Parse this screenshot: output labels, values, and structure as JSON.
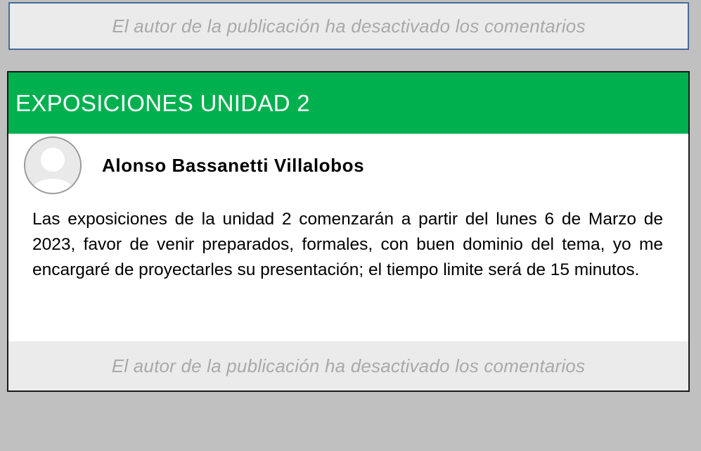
{
  "top_banner": {
    "comments_disabled_text": "El autor de la publicación ha desactivado los comentarios"
  },
  "post": {
    "title": "EXPOSICIONES UNIDAD 2",
    "author": {
      "name": "Alonso Bassanetti Villalobos",
      "avatar_icon": "user-avatar-icon"
    },
    "body": "Las exposiciones de la unidad 2 comenzarán a partir del lunes 6 de Marzo de 2023, favor de venir preparados, formales, con buen dominio del tema, yo me encargaré de proyectarles su presentación; el tiempo limite será de 15 minutos.",
    "footer_text": "El autor de la publicación ha desactivado los comentarios"
  },
  "colors": {
    "header_green": "#00b04f",
    "background_gray": "#c0c0c0",
    "note_gray": "#a9a9a9",
    "banner_border_blue": "#4a6b96"
  }
}
